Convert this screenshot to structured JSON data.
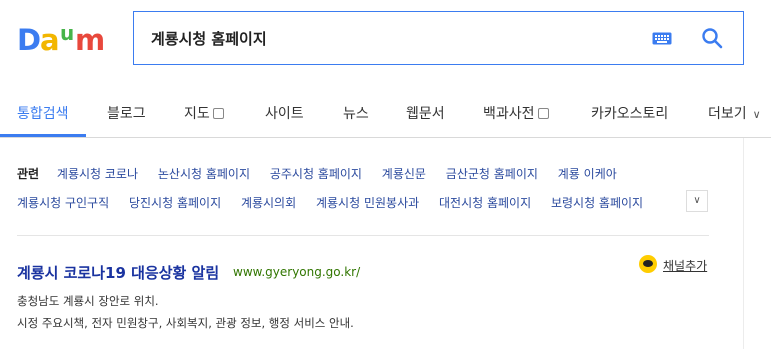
{
  "logo": {
    "text": "Daum"
  },
  "search": {
    "value": "계룡시청 홈페이지"
  },
  "tabs": [
    {
      "label": "통합검색",
      "active": true
    },
    {
      "label": "블로그"
    },
    {
      "label": "지도"
    },
    {
      "label": "사이트"
    },
    {
      "label": "뉴스"
    },
    {
      "label": "웹문서"
    },
    {
      "label": "백과사전"
    },
    {
      "label": "카카오스토리"
    },
    {
      "label": "더보기"
    }
  ],
  "related": {
    "label": "관련",
    "row1": [
      "계룡시청 코로나",
      "논산시청 홈페이지",
      "공주시청 홈페이지",
      "계룡신문",
      "금산군청 홈페이지",
      "계룡 이케아"
    ],
    "row2": [
      "계룡시청 구인구직",
      "당진시청 홈페이지",
      "계룡시의회",
      "계룡시청 민원봉사과",
      "대전시청 홈페이지",
      "보령시청 홈페이지"
    ]
  },
  "result": {
    "title": "계룡시 코로나19 대응상황 알림",
    "url": "www.gyeryong.go.kr/",
    "channel": "채널추가",
    "desc1": "충청남도 계룡시 장안로 위치.",
    "desc2": "시정 주요시책, 전자 민원창구, 사회복지, 관광 정보, 행정 서비스 안내."
  },
  "colors": {
    "accent": "#3b7cf0",
    "link": "#1a33a0",
    "url": "#317600",
    "kakao": "#ffcd00"
  }
}
